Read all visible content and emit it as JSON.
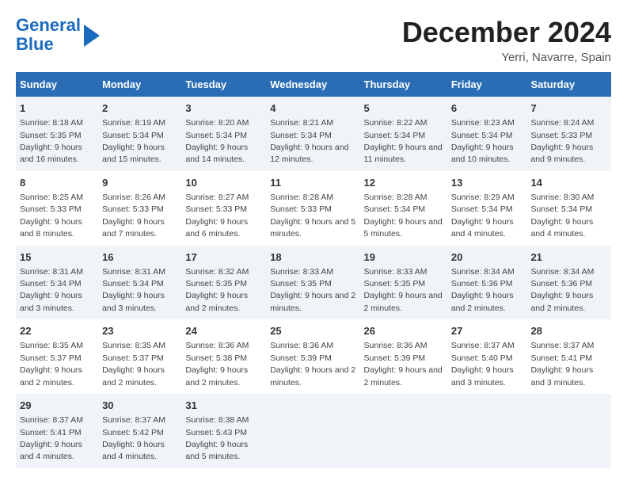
{
  "header": {
    "logo_line1": "General",
    "logo_line2": "Blue",
    "month": "December 2024",
    "location": "Yerri, Navarre, Spain"
  },
  "columns": [
    "Sunday",
    "Monday",
    "Tuesday",
    "Wednesday",
    "Thursday",
    "Friday",
    "Saturday"
  ],
  "weeks": [
    [
      {
        "day": "1",
        "sunrise": "8:18 AM",
        "sunset": "5:35 PM",
        "daylight": "9 hours and 16 minutes."
      },
      {
        "day": "2",
        "sunrise": "8:19 AM",
        "sunset": "5:34 PM",
        "daylight": "9 hours and 15 minutes."
      },
      {
        "day": "3",
        "sunrise": "8:20 AM",
        "sunset": "5:34 PM",
        "daylight": "9 hours and 14 minutes."
      },
      {
        "day": "4",
        "sunrise": "8:21 AM",
        "sunset": "5:34 PM",
        "daylight": "9 hours and 12 minutes."
      },
      {
        "day": "5",
        "sunrise": "8:22 AM",
        "sunset": "5:34 PM",
        "daylight": "9 hours and 11 minutes."
      },
      {
        "day": "6",
        "sunrise": "8:23 AM",
        "sunset": "5:34 PM",
        "daylight": "9 hours and 10 minutes."
      },
      {
        "day": "7",
        "sunrise": "8:24 AM",
        "sunset": "5:33 PM",
        "daylight": "9 hours and 9 minutes."
      }
    ],
    [
      {
        "day": "8",
        "sunrise": "8:25 AM",
        "sunset": "5:33 PM",
        "daylight": "9 hours and 8 minutes."
      },
      {
        "day": "9",
        "sunrise": "8:26 AM",
        "sunset": "5:33 PM",
        "daylight": "9 hours and 7 minutes."
      },
      {
        "day": "10",
        "sunrise": "8:27 AM",
        "sunset": "5:33 PM",
        "daylight": "9 hours and 6 minutes."
      },
      {
        "day": "11",
        "sunrise": "8:28 AM",
        "sunset": "5:33 PM",
        "daylight": "9 hours and 5 minutes."
      },
      {
        "day": "12",
        "sunrise": "8:28 AM",
        "sunset": "5:34 PM",
        "daylight": "9 hours and 5 minutes."
      },
      {
        "day": "13",
        "sunrise": "8:29 AM",
        "sunset": "5:34 PM",
        "daylight": "9 hours and 4 minutes."
      },
      {
        "day": "14",
        "sunrise": "8:30 AM",
        "sunset": "5:34 PM",
        "daylight": "9 hours and 4 minutes."
      }
    ],
    [
      {
        "day": "15",
        "sunrise": "8:31 AM",
        "sunset": "5:34 PM",
        "daylight": "9 hours and 3 minutes."
      },
      {
        "day": "16",
        "sunrise": "8:31 AM",
        "sunset": "5:34 PM",
        "daylight": "9 hours and 3 minutes."
      },
      {
        "day": "17",
        "sunrise": "8:32 AM",
        "sunset": "5:35 PM",
        "daylight": "9 hours and 2 minutes."
      },
      {
        "day": "18",
        "sunrise": "8:33 AM",
        "sunset": "5:35 PM",
        "daylight": "9 hours and 2 minutes."
      },
      {
        "day": "19",
        "sunrise": "8:33 AM",
        "sunset": "5:35 PM",
        "daylight": "9 hours and 2 minutes."
      },
      {
        "day": "20",
        "sunrise": "8:34 AM",
        "sunset": "5:36 PM",
        "daylight": "9 hours and 2 minutes."
      },
      {
        "day": "21",
        "sunrise": "8:34 AM",
        "sunset": "5:36 PM",
        "daylight": "9 hours and 2 minutes."
      }
    ],
    [
      {
        "day": "22",
        "sunrise": "8:35 AM",
        "sunset": "5:37 PM",
        "daylight": "9 hours and 2 minutes."
      },
      {
        "day": "23",
        "sunrise": "8:35 AM",
        "sunset": "5:37 PM",
        "daylight": "9 hours and 2 minutes."
      },
      {
        "day": "24",
        "sunrise": "8:36 AM",
        "sunset": "5:38 PM",
        "daylight": "9 hours and 2 minutes."
      },
      {
        "day": "25",
        "sunrise": "8:36 AM",
        "sunset": "5:39 PM",
        "daylight": "9 hours and 2 minutes."
      },
      {
        "day": "26",
        "sunrise": "8:36 AM",
        "sunset": "5:39 PM",
        "daylight": "9 hours and 2 minutes."
      },
      {
        "day": "27",
        "sunrise": "8:37 AM",
        "sunset": "5:40 PM",
        "daylight": "9 hours and 3 minutes."
      },
      {
        "day": "28",
        "sunrise": "8:37 AM",
        "sunset": "5:41 PM",
        "daylight": "9 hours and 3 minutes."
      }
    ],
    [
      {
        "day": "29",
        "sunrise": "8:37 AM",
        "sunset": "5:41 PM",
        "daylight": "9 hours and 4 minutes."
      },
      {
        "day": "30",
        "sunrise": "8:37 AM",
        "sunset": "5:42 PM",
        "daylight": "9 hours and 4 minutes."
      },
      {
        "day": "31",
        "sunrise": "8:38 AM",
        "sunset": "5:43 PM",
        "daylight": "9 hours and 5 minutes."
      },
      null,
      null,
      null,
      null
    ]
  ]
}
